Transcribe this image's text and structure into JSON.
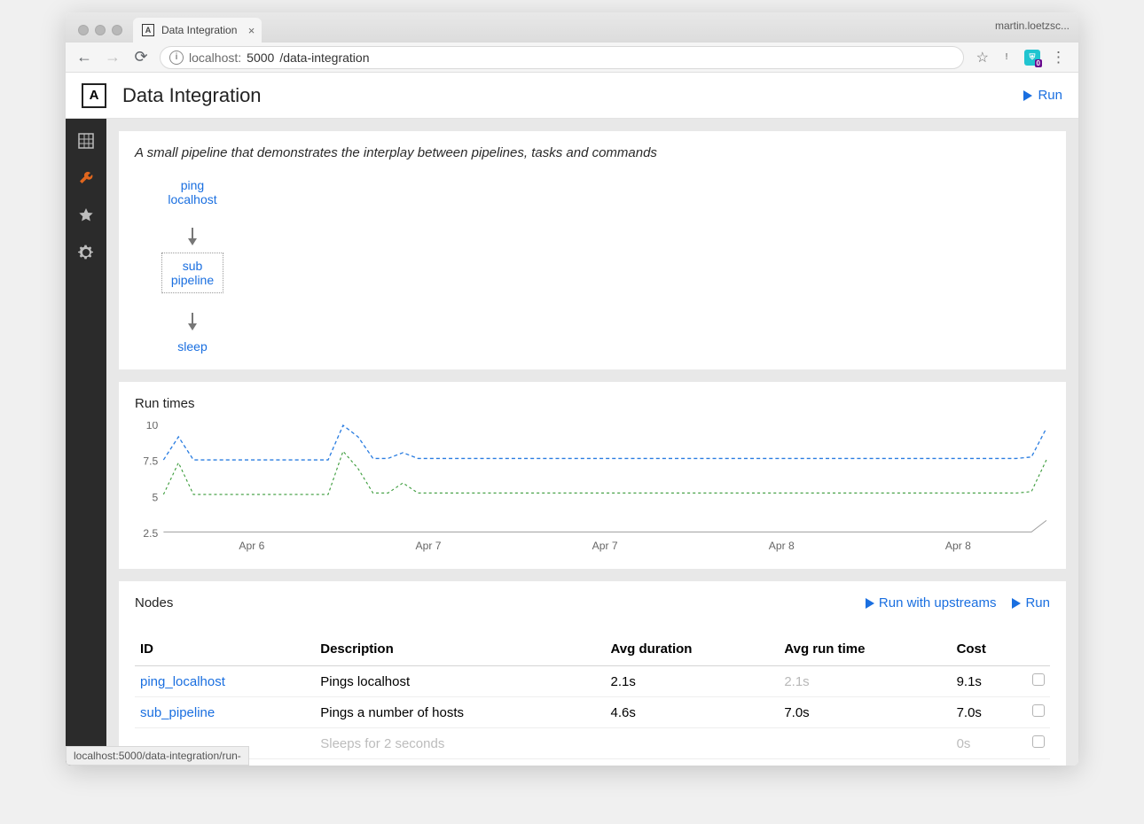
{
  "browser": {
    "tab_title": "Data Integration",
    "profile": "martin.loetzsc...",
    "url_host": "localhost:",
    "url_port": "5000",
    "url_path": "/data-integration",
    "status_bar": "localhost:5000/data-integration/run-"
  },
  "header": {
    "title": "Data Integration",
    "run_label": "Run"
  },
  "sidebar": {
    "items": [
      "grid",
      "wrench",
      "star",
      "gear"
    ]
  },
  "pipeline": {
    "description": "A small pipeline that demonstrates the interplay between pipelines, tasks and commands",
    "nodes": [
      "ping\nlocalhost",
      "sub\npipeline",
      "sleep"
    ]
  },
  "runtimes": {
    "heading": "Run times"
  },
  "nodes_section": {
    "heading": "Nodes",
    "action_upstreams": "Run with upstreams",
    "action_run": "Run",
    "columns": [
      "ID",
      "Description",
      "Avg duration",
      "Avg run time",
      "Cost"
    ],
    "rows": [
      {
        "id": "ping_localhost",
        "desc": "Pings localhost",
        "dur": "2.1s",
        "rt": "2.1s",
        "rt_muted": true,
        "cost": "9.1s"
      },
      {
        "id": "sub_pipeline",
        "desc": "Pings a number of hosts",
        "dur": "4.6s",
        "rt": "7.0s",
        "rt_muted": false,
        "cost": "7.0s"
      },
      {
        "id": "",
        "desc": "Sleeps for 2 seconds",
        "dur": "",
        "rt": "",
        "rt_muted": false,
        "cost": "0s",
        "faded": true
      }
    ]
  },
  "chart_data": {
    "type": "line",
    "title": "Run times",
    "xlabel": "",
    "ylabel": "",
    "ylim": [
      2.5,
      10
    ],
    "y_ticks": [
      2.5,
      5,
      7.5,
      10
    ],
    "x_categories": [
      "Apr 6",
      "Apr 7",
      "Apr 7",
      "Apr 8",
      "Apr 8"
    ],
    "series": [
      {
        "name": "blue",
        "color": "#2a7de1",
        "values": [
          7.6,
          9.2,
          7.6,
          7.6,
          7.6,
          7.6,
          7.6,
          7.6,
          7.6,
          7.6,
          7.6,
          7.6,
          10.0,
          9.2,
          7.7,
          7.7,
          8.1,
          7.7,
          7.7,
          7.7,
          7.7,
          7.7,
          7.7,
          7.7,
          7.7,
          7.7,
          7.7,
          7.7,
          7.7,
          7.7,
          7.7,
          7.7,
          7.7,
          7.7,
          7.7,
          7.7,
          7.7,
          7.7,
          7.7,
          7.7,
          7.7,
          7.7,
          7.7,
          7.7,
          7.7,
          7.7,
          7.7,
          7.7,
          7.7,
          7.7,
          7.7,
          7.7,
          7.7,
          7.7,
          7.7,
          7.7,
          7.7,
          7.7,
          7.8,
          9.8
        ]
      },
      {
        "name": "green",
        "color": "#3a9b3a",
        "values": [
          5.2,
          7.4,
          5.2,
          5.2,
          5.2,
          5.2,
          5.2,
          5.2,
          5.2,
          5.2,
          5.2,
          5.2,
          8.2,
          7.0,
          5.3,
          5.3,
          6.0,
          5.3,
          5.3,
          5.3,
          5.3,
          5.3,
          5.3,
          5.3,
          5.3,
          5.3,
          5.3,
          5.3,
          5.3,
          5.3,
          5.3,
          5.3,
          5.3,
          5.3,
          5.3,
          5.3,
          5.3,
          5.3,
          5.3,
          5.3,
          5.3,
          5.3,
          5.3,
          5.3,
          5.3,
          5.3,
          5.3,
          5.3,
          5.3,
          5.3,
          5.3,
          5.3,
          5.3,
          5.3,
          5.3,
          5.3,
          5.3,
          5.3,
          5.4,
          7.6
        ]
      },
      {
        "name": "grey",
        "color": "#9e9e9e",
        "values": [
          2.6,
          2.6,
          2.6,
          2.6,
          2.6,
          2.6,
          2.6,
          2.6,
          2.6,
          2.6,
          2.6,
          2.6,
          2.6,
          2.6,
          2.6,
          2.6,
          2.6,
          2.6,
          2.6,
          2.6,
          2.6,
          2.6,
          2.6,
          2.6,
          2.6,
          2.6,
          2.6,
          2.6,
          2.6,
          2.6,
          2.6,
          2.6,
          2.6,
          2.6,
          2.6,
          2.6,
          2.6,
          2.6,
          2.6,
          2.6,
          2.6,
          2.6,
          2.6,
          2.6,
          2.6,
          2.6,
          2.6,
          2.6,
          2.6,
          2.6,
          2.6,
          2.6,
          2.6,
          2.6,
          2.6,
          2.6,
          2.6,
          2.6,
          2.6,
          3.4
        ]
      }
    ]
  }
}
